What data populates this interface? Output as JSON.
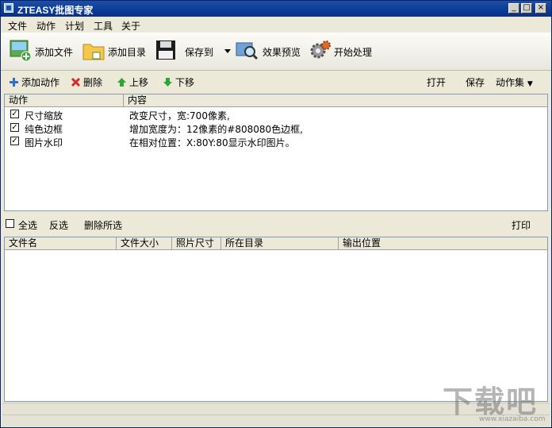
{
  "window": {
    "title": "ZTEASY批图专家"
  },
  "menu": {
    "items": [
      "文件",
      "动作",
      "计划",
      "工具",
      "关于"
    ]
  },
  "toolbar": {
    "add_file": "添加文件",
    "add_dir": "添加目录",
    "save_to": "保存到",
    "preview": "效果预览",
    "start": "开始处理"
  },
  "actions_bar": {
    "add_action": "添加动作",
    "delete": "删除",
    "move_up": "上移",
    "move_down": "下移",
    "open": "打开",
    "save": "保存",
    "action_set": "动作集"
  },
  "action_table": {
    "headers": [
      "动作",
      "内容"
    ],
    "rows": [
      {
        "checked": true,
        "action": "尺寸缩放",
        "content": "改变尺寸，宽:700像素,"
      },
      {
        "checked": true,
        "action": "纯色边框",
        "content": "增加宽度为：12像素的#808080色边框,"
      },
      {
        "checked": true,
        "action": "图片水印",
        "content": "在相对位置：X:80Y:80显示水印图片。"
      }
    ]
  },
  "selection_bar": {
    "select_all": "全选",
    "invert": "反选",
    "delete_selected": "删除所选",
    "print": "打印"
  },
  "file_table": {
    "headers": [
      "文件名",
      "文件大小",
      "照片尺寸",
      "所在目录",
      "输出位置"
    ]
  },
  "watermark": {
    "brand": "下载吧",
    "url": "www.xiazaiba.com"
  },
  "colors": {
    "title_bar": "#0b3f9b",
    "grid_border": "#7f9db9"
  }
}
